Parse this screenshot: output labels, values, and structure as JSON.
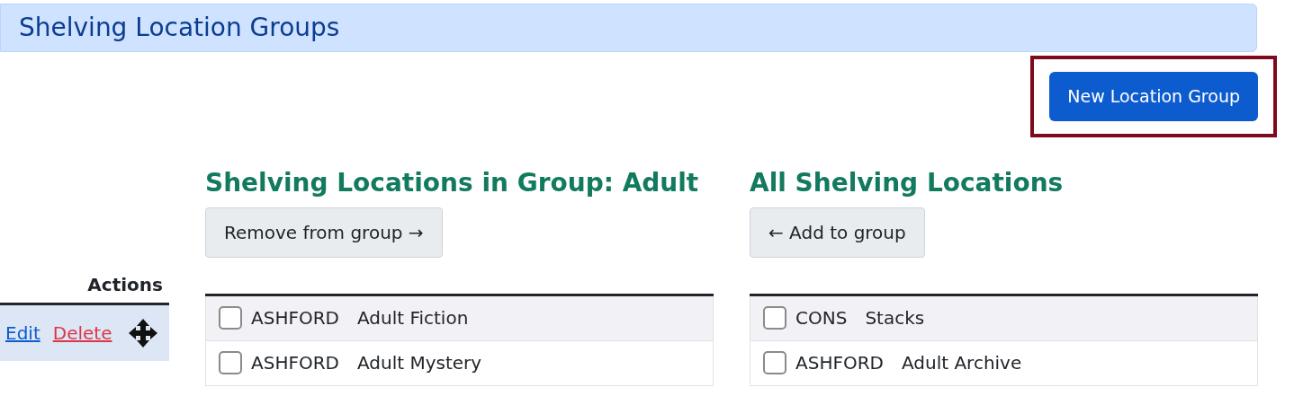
{
  "page_title": "Shelving Location Groups",
  "new_button": {
    "label": "New Location Group",
    "highlighted": true
  },
  "actions": {
    "header": "Actions",
    "links": [
      {
        "label": "Edit",
        "kind": "edit"
      },
      {
        "label": "Delete",
        "kind": "delete"
      }
    ]
  },
  "group_panel": {
    "title": "Shelving Locations in Group: Adult",
    "button": "Remove from group →",
    "rows": [
      {
        "code": "ASHFORD",
        "name": "Adult Fiction",
        "checked": false
      },
      {
        "code": "ASHFORD",
        "name": "Adult Mystery",
        "checked": false
      }
    ]
  },
  "all_panel": {
    "title": "All Shelving Locations",
    "button": "← Add to group",
    "rows": [
      {
        "code": "CONS",
        "name": "Stacks",
        "checked": false
      },
      {
        "code": "ASHFORD",
        "name": "Adult Archive",
        "checked": false
      }
    ]
  }
}
